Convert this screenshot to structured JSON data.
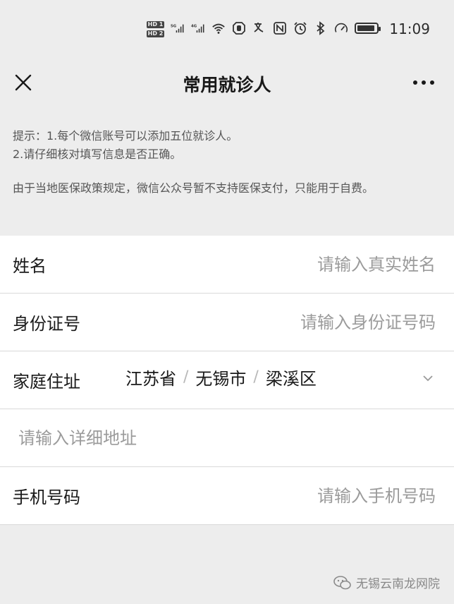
{
  "status_bar": {
    "sim1": "HD 1",
    "sim2": "HD 2",
    "net1": "5G",
    "net2": "4G",
    "time": "11:09",
    "battery_level": 0.9
  },
  "nav": {
    "title": "常用就诊人",
    "close_icon": "close-icon",
    "more_icon": "more-icon"
  },
  "notice": {
    "line1": "提示：1.每个微信账号可以添加五位就诊人。",
    "line2": "2.请仔细核对填写信息是否正确。",
    "line3": "由于当地医保政策规定，微信公众号暂不支持医保支付，只能用于自费。"
  },
  "form": {
    "name": {
      "label": "姓名",
      "placeholder": "请输入真实姓名"
    },
    "id_number": {
      "label": "身份证号",
      "placeholder": "请输入身份证号码"
    },
    "address": {
      "label": "家庭住址",
      "province": "江苏省",
      "city": "无锡市",
      "district": "梁溪区",
      "separator": "/"
    },
    "detail_address": {
      "placeholder": "请输入详细地址"
    },
    "phone": {
      "label": "手机号码",
      "placeholder": "请输入手机号码"
    }
  },
  "watermark": {
    "text": "无锡云南龙网院"
  },
  "colors": {
    "background": "#ededed",
    "card": "#ffffff",
    "placeholder": "#9b9b9b",
    "text": "#191919"
  }
}
